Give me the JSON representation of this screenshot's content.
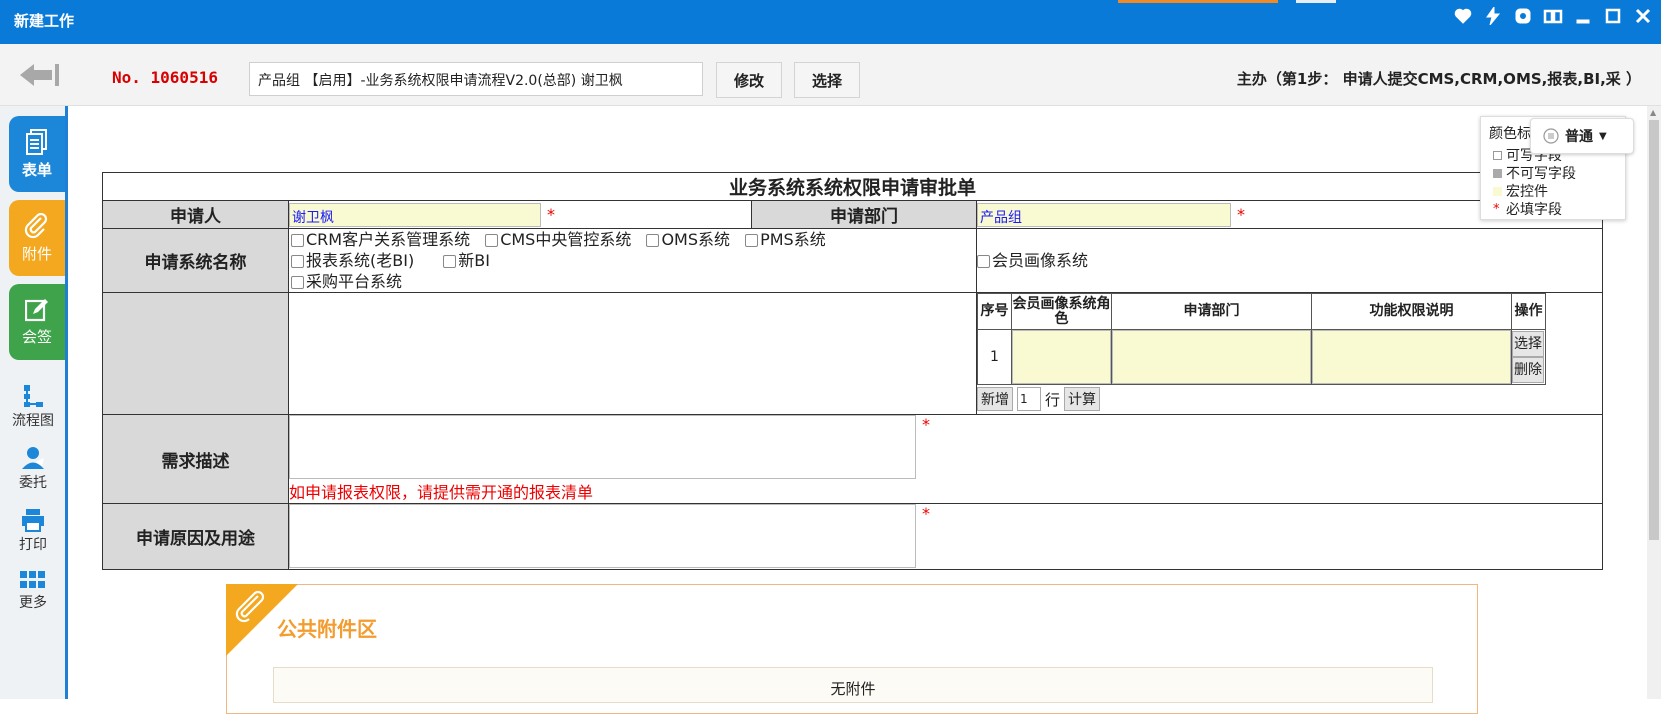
{
  "window": {
    "title": "新建工作",
    "controls": [
      "heart-icon",
      "flash-icon",
      "gear-icon",
      "book-icon",
      "minimize-icon",
      "maximize-icon",
      "close-icon"
    ]
  },
  "toolbar": {
    "run_no": "No. 1060516",
    "run_name": "产品组 【启用】-业务系统权限申请流程V2.0(总部) 谢卫枫",
    "modify_label": "修改",
    "select_label": "选择",
    "step_info": "主办（第1步： 申请人提交CMS,CRM,OMS,报表,BI,采 ）"
  },
  "sidebar": {
    "tabs": [
      {
        "label": "表单",
        "icon": "form-icon"
      },
      {
        "label": "附件",
        "icon": "paperclip-icon"
      },
      {
        "label": "会签",
        "icon": "edit-icon"
      }
    ],
    "tools": [
      {
        "label": "流程图",
        "icon": "flowchart-icon"
      },
      {
        "label": "委托",
        "icon": "delegate-icon"
      },
      {
        "label": "打印",
        "icon": "printer-icon"
      },
      {
        "label": "更多",
        "icon": "grid-icon"
      }
    ]
  },
  "legend": {
    "title": "颜色标",
    "items": [
      {
        "label": "可写字段",
        "color": "#ffffff"
      },
      {
        "label": "不可写字段",
        "color": "#aaaaaa"
      },
      {
        "label": "宏控件",
        "color": "#fafad2"
      },
      {
        "label": "必填字段",
        "color": "#e00000"
      }
    ]
  },
  "view_mode": {
    "label": "普通"
  },
  "form": {
    "title": "业务系统系统权限申请审批单",
    "applicant_label": "申请人",
    "applicant_value": "谢卫枫",
    "dept_label": "申请部门",
    "dept_value": "产品组",
    "required_mark": "*",
    "system_label": "申请系统名称",
    "systems": [
      "CRM客户关系管理系统",
      "CMS中央管控系统",
      "OMS系统",
      "PMS系统",
      "报表系统(老BI)",
      "新BI",
      "采购平台系统"
    ],
    "member_portrait": "会员画像系统",
    "subtable": {
      "headers": [
        "序号",
        "会员画像系统角色",
        "申请部门",
        "功能权限说明",
        "操作"
      ],
      "row_no": "1",
      "select_btn": "选择",
      "delete_btn": "删除",
      "add_btn": "新增",
      "add_count": "1",
      "row_unit": "行",
      "calc_btn": "计算"
    },
    "requirement_label": "需求描述",
    "requirement_hint": "如申请报表权限，请提供需开通的报表清单",
    "reason_label": "申请原因及用途"
  },
  "attachments": {
    "title": "公共附件区",
    "empty_text": "无附件"
  }
}
